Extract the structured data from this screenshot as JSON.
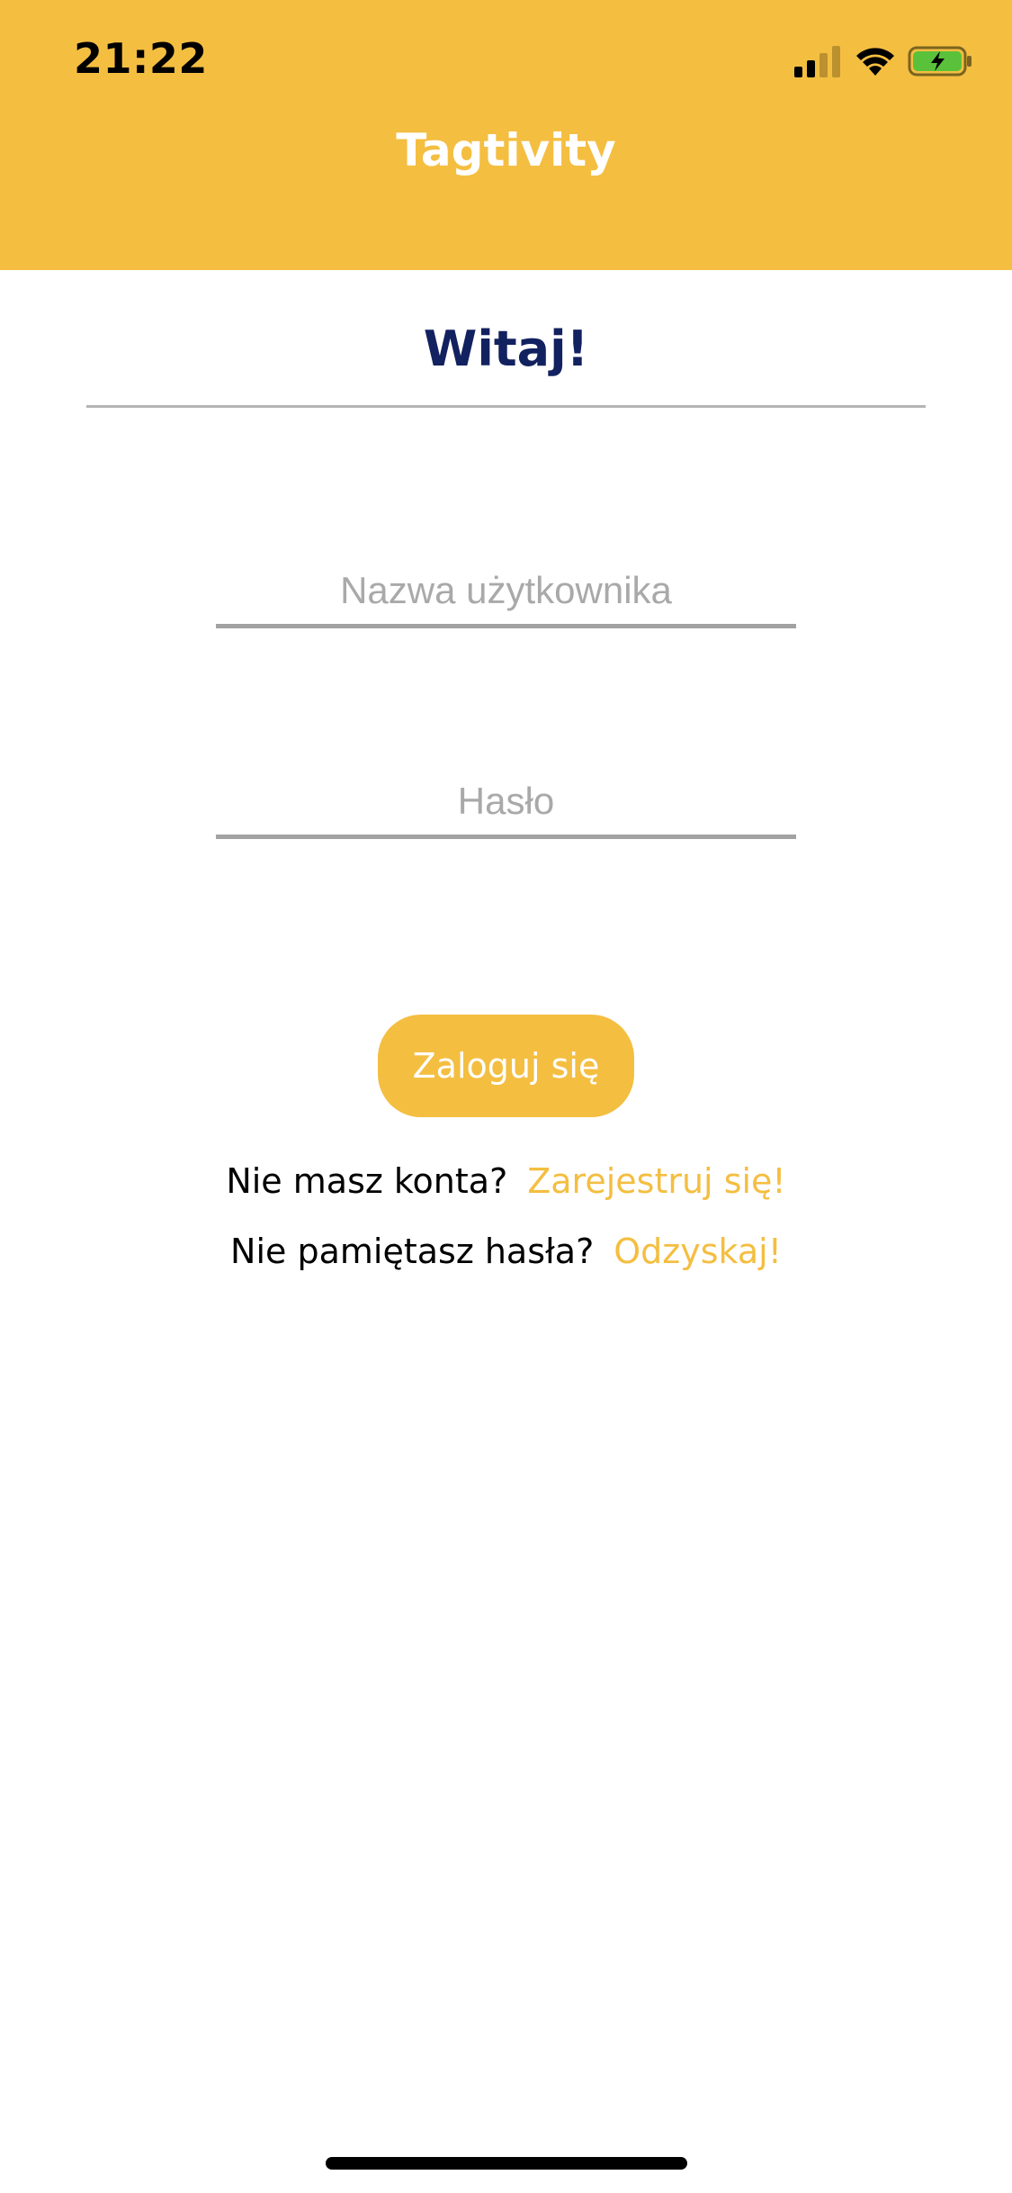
{
  "status_bar": {
    "time": "21:22",
    "icons": [
      "signal-icon",
      "wifi-icon",
      "battery-charging-icon"
    ]
  },
  "header": {
    "title": "Tagtivity"
  },
  "greeting": {
    "text": "Witaj!"
  },
  "form": {
    "username_placeholder": "Nazwa użytkownika",
    "username_value": "",
    "password_placeholder": "Hasło",
    "password_value": "",
    "login_label": "Zaloguj się"
  },
  "register": {
    "prompt": "Nie masz konta?",
    "link": "Zarejestruj się!"
  },
  "recover": {
    "prompt": "Nie pamiętasz hasła?",
    "link": "Odzyskaj!"
  },
  "colors": {
    "brand_yellow": "#F4BE41",
    "greeting_navy": "#12215F",
    "battery_green": "#5AC13A"
  }
}
